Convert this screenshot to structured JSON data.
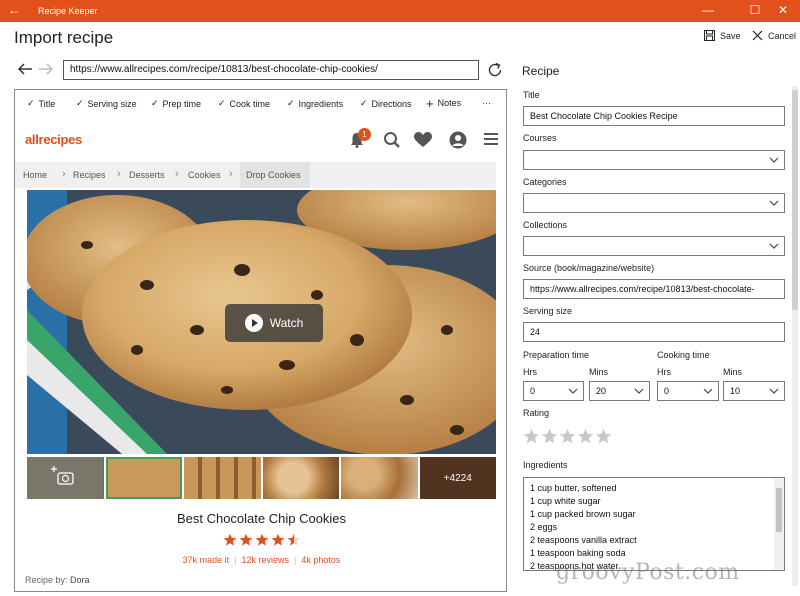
{
  "window": {
    "title": "Recipe Keeper",
    "minimize_glyph": "—",
    "maximize_glyph": "☐",
    "close_glyph": "✕"
  },
  "header": {
    "title": "Import recipe",
    "save_label": "Save",
    "cancel_label": "Cancel"
  },
  "browser": {
    "url": "https://www.allrecipes.com/recipe/10813/best-chocolate-chip-cookies/",
    "field_buttons": [
      "Title",
      "Serving size",
      "Prep time",
      "Cook time",
      "Ingredients",
      "Directions"
    ],
    "notes_label": "Notes",
    "more_label": "···"
  },
  "site": {
    "logo": "allrecipes",
    "notification_count": "1",
    "breadcrumbs": [
      "Home",
      "Recipes",
      "Desserts",
      "Cookies",
      "Drop Cookies"
    ],
    "watch_label": "Watch",
    "more_photos": "+4224",
    "recipe_name": "Best Chocolate Chip Cookies",
    "rating_stars": 4.5,
    "made_it": "37k made it",
    "reviews": "12k reviews",
    "photos": "4k photos",
    "recipe_by_label": "Recipe by:",
    "recipe_by_name": "Dora"
  },
  "panel": {
    "title": "Recipe",
    "title_label": "Title",
    "title_value": "Best Chocolate Chip Cookies Recipe",
    "courses_label": "Courses",
    "categories_label": "Categories",
    "collections_label": "Collections",
    "source_label": "Source (book/magazine/website)",
    "source_value": "https://www.allrecipes.com/recipe/10813/best-chocolate-",
    "serving_label": "Serving size",
    "serving_value": "24",
    "prep_label": "Preparation time",
    "cook_label": "Cooking time",
    "hrs_label": "Hrs",
    "mins_label": "Mins",
    "prep_hrs": "0",
    "prep_mins": "20",
    "cook_hrs": "0",
    "cook_mins": "10",
    "rating_label": "Rating",
    "rating_value": 0,
    "ingredients_label": "Ingredients",
    "ingredients": [
      "1 cup butter, softened",
      "1 cup white sugar",
      "1 cup packed brown sugar",
      "2 eggs",
      "2 teaspoons vanilla extract",
      "1 teaspoon baking soda",
      "2 teaspoons hot water"
    ]
  },
  "watermark": "groovyPost.com",
  "colors": {
    "accent": "#e0511c",
    "star": "#e0511c"
  }
}
